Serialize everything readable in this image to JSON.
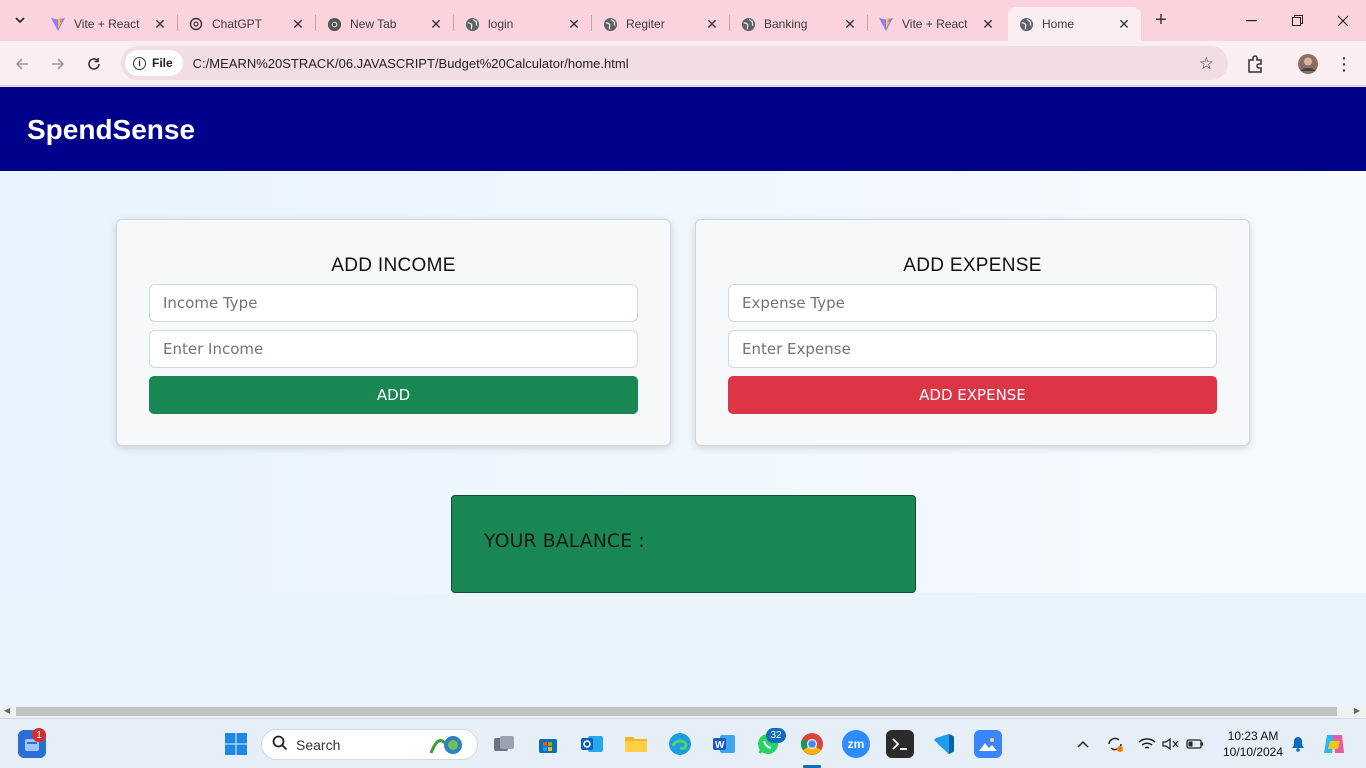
{
  "browser": {
    "tabs": [
      {
        "label": "Vite + React",
        "icon": "vite-icon"
      },
      {
        "label": "ChatGPT",
        "icon": "chatgpt-icon"
      },
      {
        "label": "New Tab",
        "icon": "chrome-icon"
      },
      {
        "label": "login",
        "icon": "globe-icon"
      },
      {
        "label": "Regiter",
        "icon": "globe-icon"
      },
      {
        "label": "Banking",
        "icon": "globe-icon"
      },
      {
        "label": "Vite + React",
        "icon": "vite-icon"
      },
      {
        "label": "Home",
        "icon": "globe-icon",
        "active": true
      }
    ],
    "site_chip": "File",
    "url": "C:/MEARN%20STRACK/06.JAVASCRIPT/Budget%20Calculator/home.html"
  },
  "app": {
    "brand": "SpendSense",
    "colors": {
      "header": "#00008b",
      "add_button": "#198754",
      "expense_button": "#dc3545",
      "balance": "#198754"
    }
  },
  "income": {
    "title": "ADD INCOME",
    "type_placeholder": "Income Type",
    "amount_placeholder": "Enter Income",
    "button_label": "ADD"
  },
  "expense": {
    "title": "ADD EXPENSE",
    "type_placeholder": "Expense Type",
    "amount_placeholder": "Enter Expense",
    "button_label": "ADD EXPENSE"
  },
  "balance": {
    "label": "YOUR BALANCE :"
  },
  "taskbar": {
    "search_label": "Search",
    "widgets_badge": "1",
    "whatsapp_badge": "32",
    "time": "10:23 AM",
    "date": "10/10/2024"
  }
}
